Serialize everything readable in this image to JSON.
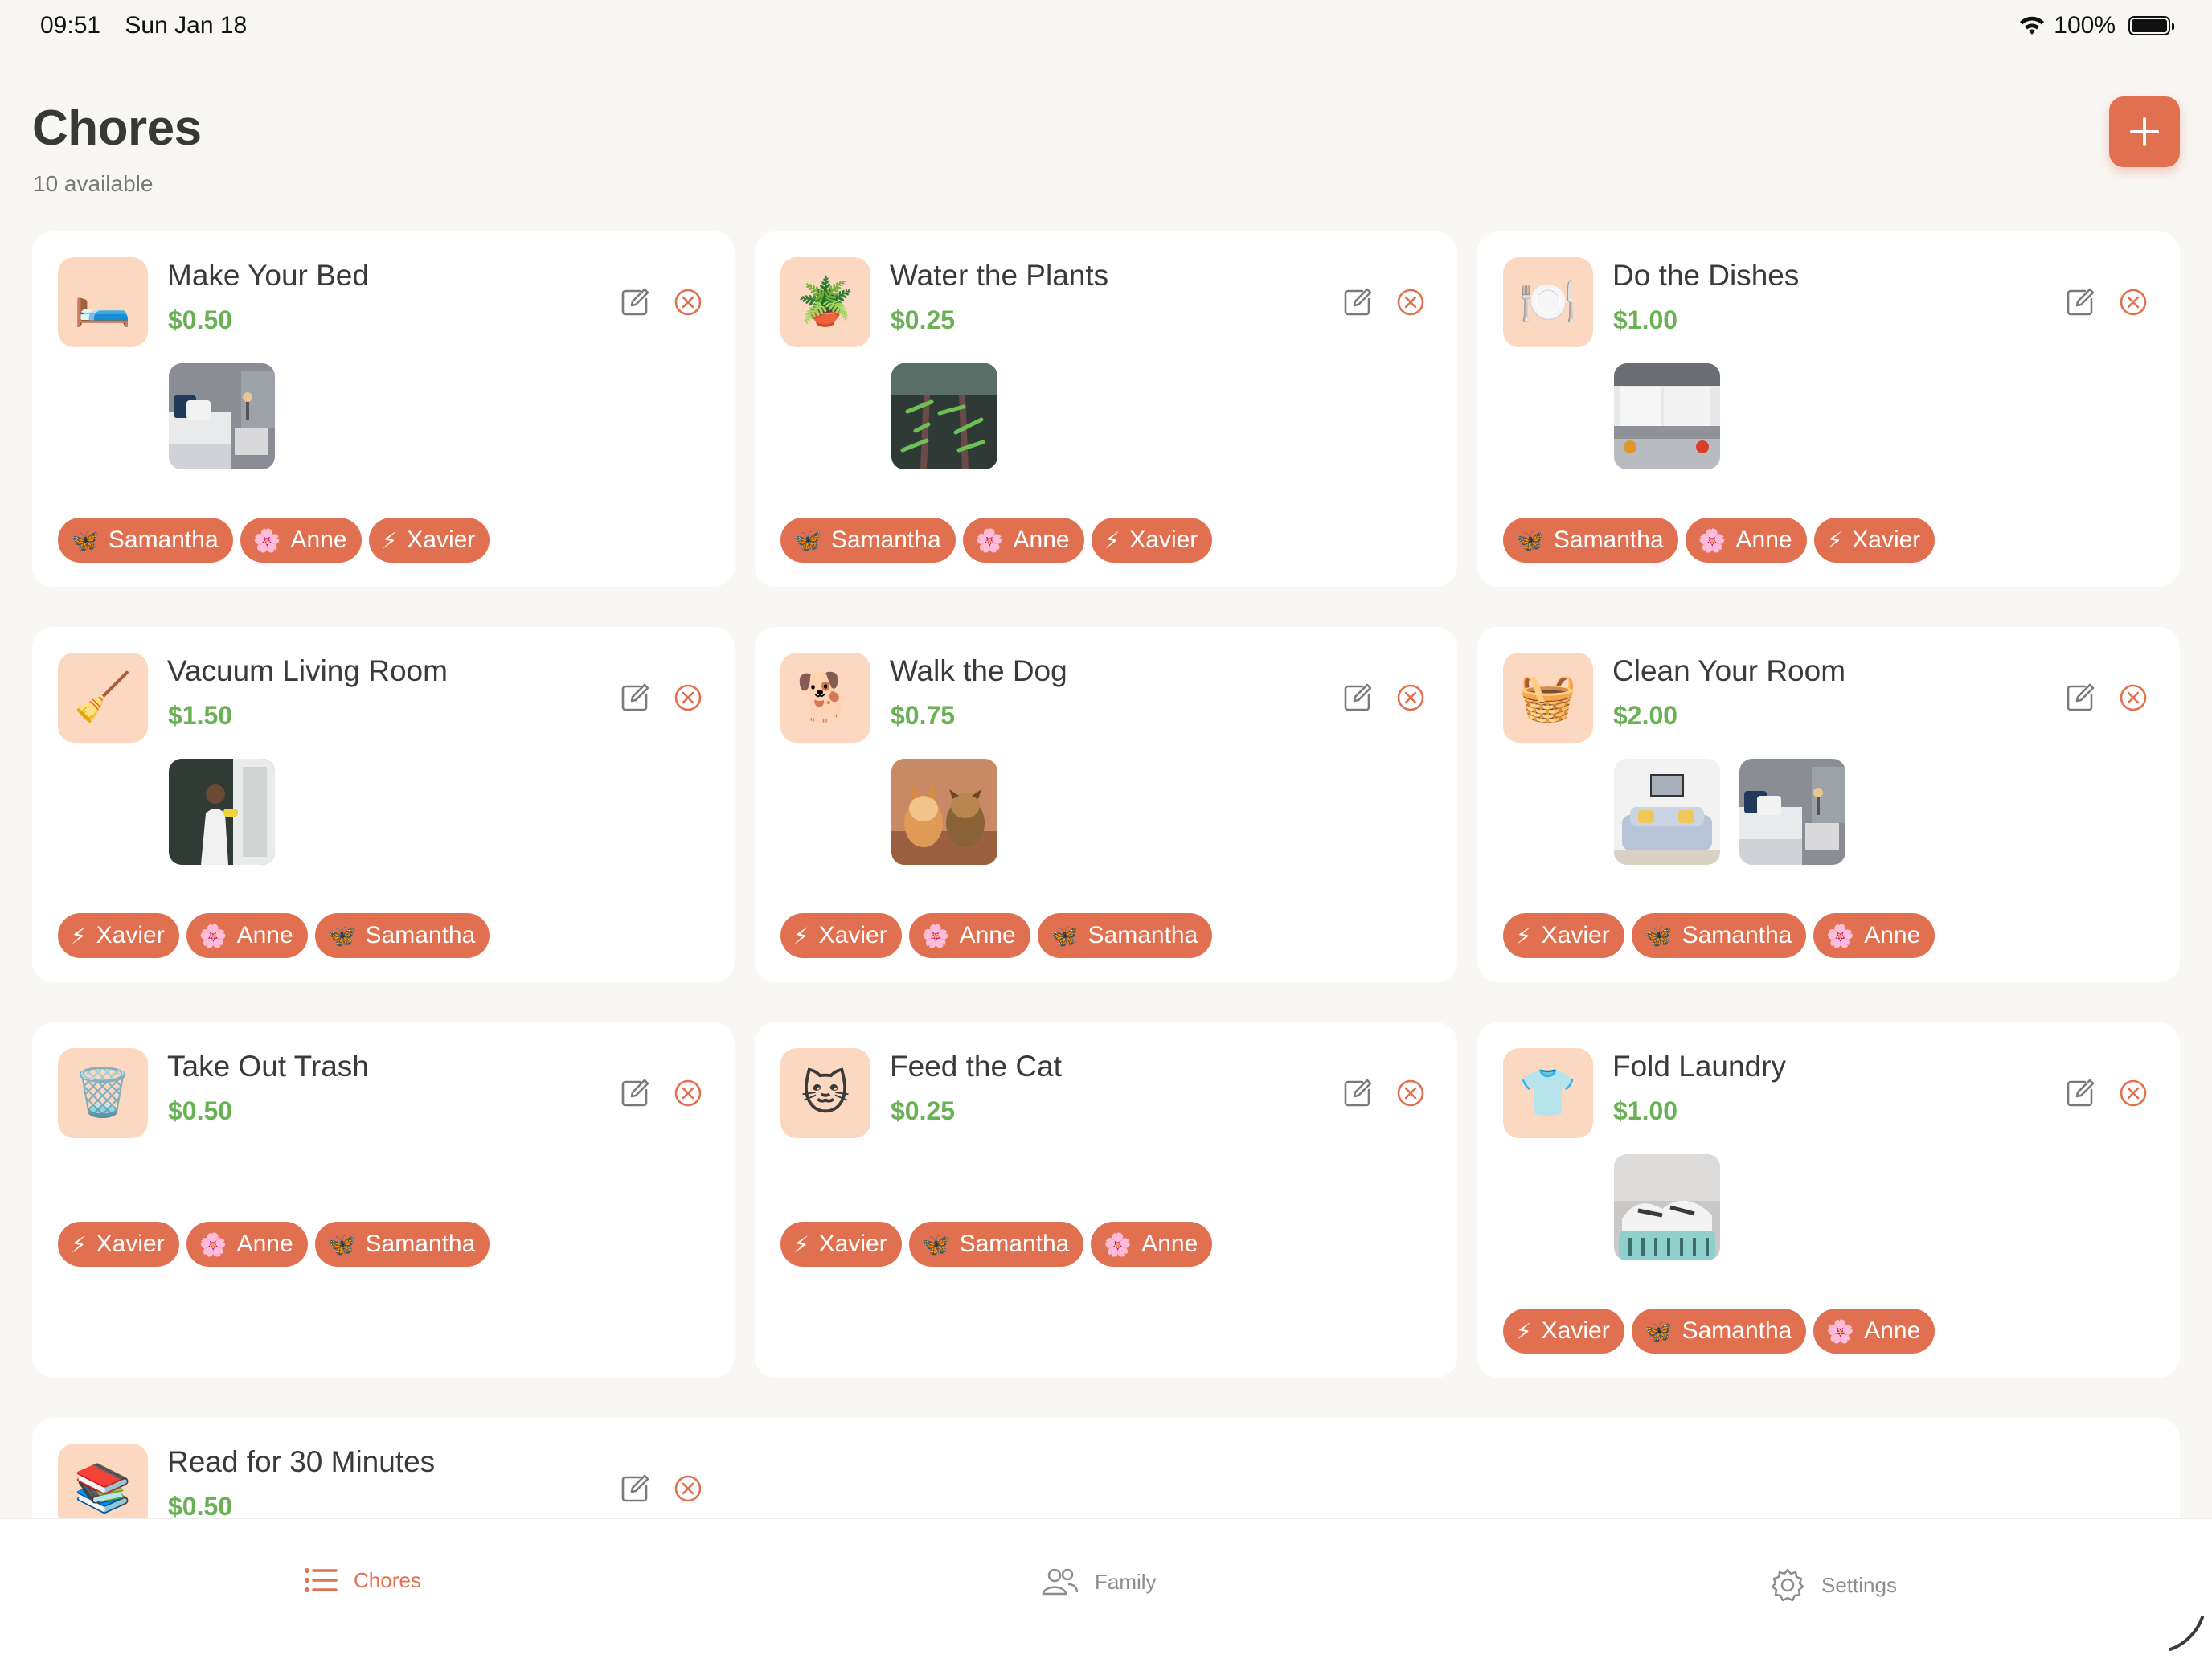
{
  "status_bar": {
    "time": "09:51",
    "date": "Sun Jan 18",
    "battery": "100%"
  },
  "header": {
    "title": "Chores",
    "subtitle": "10 available"
  },
  "colors": {
    "accent": "#e07050",
    "price": "#6ab055",
    "icon_bg": "#fdd8c0"
  },
  "chores": [
    {
      "title": "Make Your Bed",
      "price": "$0.50",
      "emoji": "🛏️",
      "photos": [
        "bedroom"
      ],
      "kids": [
        {
          "emoji": "🦋",
          "name": "Samantha"
        },
        {
          "emoji": "🌸",
          "name": "Anne"
        },
        {
          "emoji": "⚡",
          "name": "Xavier"
        }
      ]
    },
    {
      "title": "Water the Plants",
      "price": "$0.25",
      "emoji": "🪴",
      "photos": [
        "plants"
      ],
      "kids": [
        {
          "emoji": "🦋",
          "name": "Samantha"
        },
        {
          "emoji": "🌸",
          "name": "Anne"
        },
        {
          "emoji": "⚡",
          "name": "Xavier"
        }
      ]
    },
    {
      "title": "Do the Dishes",
      "price": "$1.00",
      "emoji": "🍽️",
      "photos": [
        "kitchen"
      ],
      "kids": [
        {
          "emoji": "🦋",
          "name": "Samantha"
        },
        {
          "emoji": "🌸",
          "name": "Anne"
        },
        {
          "emoji": "⚡",
          "name": "Xavier"
        }
      ]
    },
    {
      "title": "Vacuum Living Room",
      "price": "$1.50",
      "emoji": "🧹",
      "photos": [
        "cleaning"
      ],
      "kids": [
        {
          "emoji": "⚡",
          "name": "Xavier"
        },
        {
          "emoji": "🌸",
          "name": "Anne"
        },
        {
          "emoji": "🦋",
          "name": "Samantha"
        }
      ]
    },
    {
      "title": "Walk the Dog",
      "price": "$0.75",
      "emoji": "🐕",
      "photos": [
        "dogs"
      ],
      "kids": [
        {
          "emoji": "⚡",
          "name": "Xavier"
        },
        {
          "emoji": "🌸",
          "name": "Anne"
        },
        {
          "emoji": "🦋",
          "name": "Samantha"
        }
      ]
    },
    {
      "title": "Clean Your Room",
      "price": "$2.00",
      "emoji": "🧺",
      "photos": [
        "living-room",
        "bedroom"
      ],
      "kids": [
        {
          "emoji": "⚡",
          "name": "Xavier"
        },
        {
          "emoji": "🦋",
          "name": "Samantha"
        },
        {
          "emoji": "🌸",
          "name": "Anne"
        }
      ]
    },
    {
      "title": "Take Out Trash",
      "price": "$0.50",
      "emoji": "🗑️",
      "photos": [],
      "kids": [
        {
          "emoji": "⚡",
          "name": "Xavier"
        },
        {
          "emoji": "🌸",
          "name": "Anne"
        },
        {
          "emoji": "🦋",
          "name": "Samantha"
        }
      ]
    },
    {
      "title": "Feed the Cat",
      "price": "$0.25",
      "emoji": "🐱",
      "photos": [],
      "kids": [
        {
          "emoji": "⚡",
          "name": "Xavier"
        },
        {
          "emoji": "🦋",
          "name": "Samantha"
        },
        {
          "emoji": "🌸",
          "name": "Anne"
        }
      ]
    },
    {
      "title": "Fold Laundry",
      "price": "$1.00",
      "emoji": "👕",
      "photos": [
        "laundry"
      ],
      "kids": [
        {
          "emoji": "⚡",
          "name": "Xavier"
        },
        {
          "emoji": "🦋",
          "name": "Samantha"
        },
        {
          "emoji": "🌸",
          "name": "Anne"
        }
      ]
    },
    {
      "title": "Read for 30 Minutes",
      "price": "$0.50",
      "emoji": "📚",
      "photos": [],
      "kids": []
    }
  ],
  "tabs": [
    {
      "label": "Chores",
      "icon": "list-icon",
      "active": true
    },
    {
      "label": "Family",
      "icon": "people-icon",
      "active": false
    },
    {
      "label": "Settings",
      "icon": "gear-icon",
      "active": false
    }
  ]
}
